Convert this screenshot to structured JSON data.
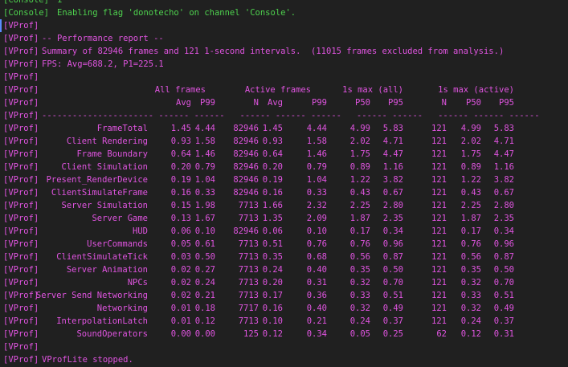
{
  "colors": {
    "background": "#202020",
    "console_green": "#4ed14e",
    "vprof_magenta": "#e054e0",
    "selection_marker": "#5a8cff"
  },
  "console": {
    "lines": [
      {
        "prefix": "[Console]",
        "text": "1"
      },
      {
        "prefix": "[Console]",
        "text": "Enabling flag 'donotecho' on channel 'Console'."
      }
    ]
  },
  "vprof": {
    "prefix": "[VProf]",
    "header_lines": [
      "",
      "-- Performance report --",
      "Summary of 82946 frames and 121 1-second intervals.  (11015 frames excluded from analysis.)",
      "FPS: Avg=688.2, P1=225.1",
      ""
    ],
    "table": {
      "group_headers": [
        "All frames",
        "Active frames",
        "1s max (all)",
        "1s max (active)"
      ],
      "column_headers": [
        "Avg",
        "P99",
        "N",
        "Avg",
        "P99",
        "P50",
        "P95",
        "N",
        "P50",
        "P95"
      ],
      "separator": "---------------------- ------ ------   ------ ------ ------   ------ ------   ------ ------ ------",
      "rows": [
        {
          "name": "FrameTotal",
          "values": [
            "1.45",
            "4.44",
            "82946",
            "1.45",
            "4.44",
            "4.99",
            "5.83",
            "121",
            "4.99",
            "5.83"
          ]
        },
        {
          "name": "Client Rendering",
          "values": [
            "0.93",
            "1.58",
            "82946",
            "0.93",
            "1.58",
            "2.02",
            "4.71",
            "121",
            "2.02",
            "4.71"
          ]
        },
        {
          "name": "Frame Boundary",
          "values": [
            "0.64",
            "1.46",
            "82946",
            "0.64",
            "1.46",
            "1.75",
            "4.47",
            "121",
            "1.75",
            "4.47"
          ]
        },
        {
          "name": "Client Simulation",
          "values": [
            "0.20",
            "0.79",
            "82946",
            "0.20",
            "0.79",
            "0.89",
            "1.16",
            "121",
            "0.89",
            "1.16"
          ]
        },
        {
          "name": "Present_RenderDevice",
          "values": [
            "0.19",
            "1.04",
            "82946",
            "0.19",
            "1.04",
            "1.22",
            "3.82",
            "121",
            "1.22",
            "3.82"
          ]
        },
        {
          "name": "ClientSimulateFrame",
          "values": [
            "0.16",
            "0.33",
            "82946",
            "0.16",
            "0.33",
            "0.43",
            "0.67",
            "121",
            "0.43",
            "0.67"
          ]
        },
        {
          "name": "Server Simulation",
          "values": [
            "0.15",
            "1.98",
            "7713",
            "1.66",
            "2.32",
            "2.25",
            "2.80",
            "121",
            "2.25",
            "2.80"
          ]
        },
        {
          "name": "Server Game",
          "values": [
            "0.13",
            "1.67",
            "7713",
            "1.35",
            "2.09",
            "1.87",
            "2.35",
            "121",
            "1.87",
            "2.35"
          ]
        },
        {
          "name": "HUD",
          "values": [
            "0.06",
            "0.10",
            "82946",
            "0.06",
            "0.10",
            "0.17",
            "0.34",
            "121",
            "0.17",
            "0.34"
          ]
        },
        {
          "name": "UserCommands",
          "values": [
            "0.05",
            "0.61",
            "7713",
            "0.51",
            "0.76",
            "0.76",
            "0.96",
            "121",
            "0.76",
            "0.96"
          ]
        },
        {
          "name": "ClientSimulateTick",
          "values": [
            "0.03",
            "0.50",
            "7713",
            "0.35",
            "0.68",
            "0.56",
            "0.87",
            "121",
            "0.56",
            "0.87"
          ]
        },
        {
          "name": "Server Animation",
          "values": [
            "0.02",
            "0.27",
            "7713",
            "0.24",
            "0.40",
            "0.35",
            "0.50",
            "121",
            "0.35",
            "0.50"
          ]
        },
        {
          "name": "NPCs",
          "values": [
            "0.02",
            "0.24",
            "7713",
            "0.20",
            "0.31",
            "0.32",
            "0.70",
            "121",
            "0.32",
            "0.70"
          ]
        },
        {
          "name": "Server Send Networking",
          "values": [
            "0.02",
            "0.21",
            "7713",
            "0.17",
            "0.36",
            "0.33",
            "0.51",
            "121",
            "0.33",
            "0.51"
          ]
        },
        {
          "name": "Networking",
          "values": [
            "0.01",
            "0.18",
            "7717",
            "0.16",
            "0.40",
            "0.32",
            "0.49",
            "121",
            "0.32",
            "0.49"
          ]
        },
        {
          "name": "InterpolationLatch",
          "values": [
            "0.01",
            "0.12",
            "7713",
            "0.10",
            "0.21",
            "0.24",
            "0.37",
            "121",
            "0.24",
            "0.37"
          ]
        },
        {
          "name": "SoundOperators",
          "values": [
            "0.00",
            "0.00",
            "125",
            "0.12",
            "0.34",
            "0.05",
            "0.25",
            "62",
            "0.12",
            "0.31"
          ]
        }
      ]
    },
    "footer_lines": [
      "",
      "VProfLite stopped."
    ]
  }
}
